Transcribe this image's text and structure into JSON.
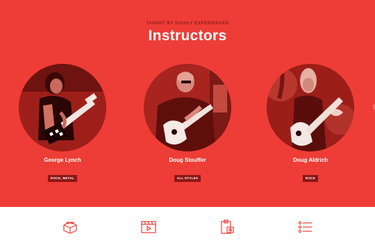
{
  "section": {
    "eyebrow": "TAUGHT BY HIGHLY EXPERIENCED",
    "title": "Instructors"
  },
  "instructors": [
    {
      "name": "George Lynch",
      "tag": "ROCK, METAL"
    },
    {
      "name": "Doug Stouffer",
      "tag": "ALL STYLES"
    },
    {
      "name": "Doug Aldrich",
      "tag": "ROCK"
    }
  ],
  "footer": {
    "icons": [
      "lego-brick-icon",
      "video-player-icon",
      "clipboard-icon",
      "list-icon"
    ]
  },
  "colors": {
    "accent": "#ee3d36",
    "tag_bg": "#8c1714",
    "footer_icon": "#ee3d36"
  }
}
